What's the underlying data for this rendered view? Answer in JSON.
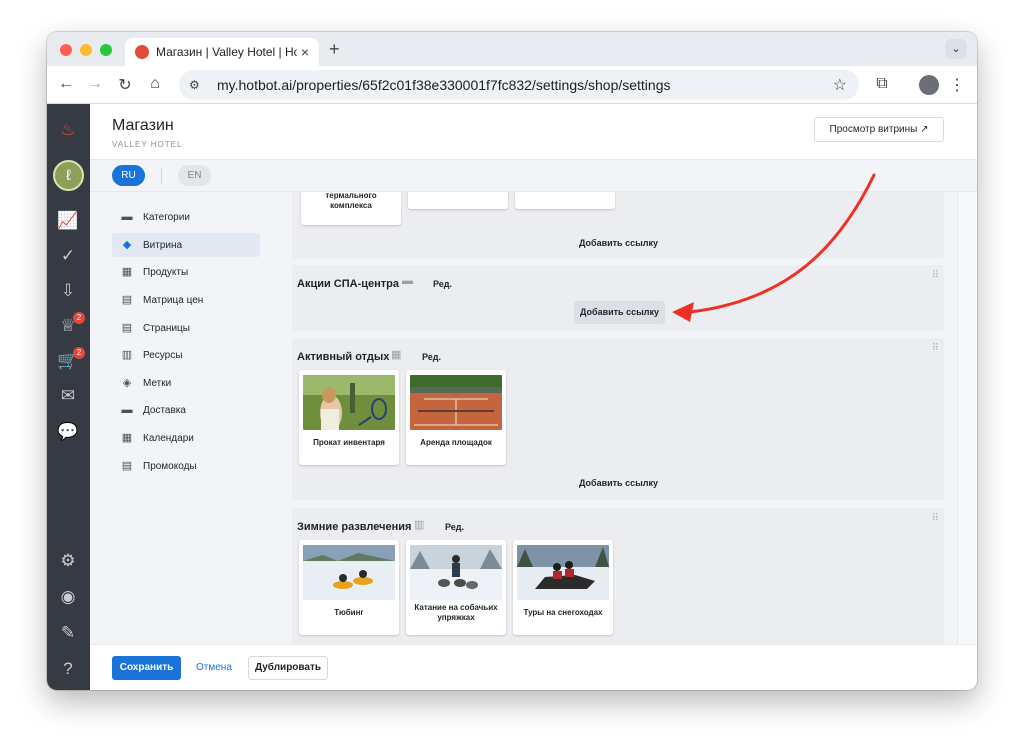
{
  "browser": {
    "tab_title": "Магазин | Valley Hotel | Hotbot",
    "tab_close": "×",
    "new_tab": "+",
    "url": "my.hotbot.ai/properties/65f2c01f38e330001f7fc832/settings/shop/settings"
  },
  "rail": {
    "badges": [
      "2",
      "2"
    ]
  },
  "header": {
    "title": "Магазин",
    "subtitle": "VALLEY HOTEL",
    "preview_label": "Просмотр витрины ↗"
  },
  "langs": [
    "RU",
    "EN"
  ],
  "nav": [
    {
      "label": "Категории",
      "icon": "▬"
    },
    {
      "label": "Витрина",
      "icon": "◆"
    },
    {
      "label": "Продукты",
      "icon": "▦"
    },
    {
      "label": "Матрица цен",
      "icon": "▤"
    },
    {
      "label": "Страницы",
      "icon": "▤"
    },
    {
      "label": "Ресурсы",
      "icon": "▥"
    },
    {
      "label": "Метки",
      "icon": "◈"
    },
    {
      "label": "Доставка",
      "icon": "▬"
    },
    {
      "label": "Календари",
      "icon": "▦"
    },
    {
      "label": "Промокоды",
      "icon": "▤"
    }
  ],
  "sections": {
    "top": {
      "card_caption": "термального комплекса",
      "add_link": "Добавить ссылку"
    },
    "spa": {
      "title": "Акции СПА-центра",
      "edit": "Ред.",
      "add_link": "Добавить ссылку"
    },
    "active": {
      "title": "Активный отдых",
      "edit": "Ред.",
      "cards": [
        "Прокат инвентаря",
        "Аренда площадок"
      ],
      "add_link": "Добавить ссылку"
    },
    "winter": {
      "title": "Зимние развлечения",
      "edit": "Ред.",
      "cards": [
        "Тюбинг",
        "Катание на собачьих упряжках",
        "Туры на снегоходах"
      ]
    }
  },
  "footer": {
    "save": "Сохранить",
    "cancel": "Отмена",
    "duplicate": "Дублировать"
  },
  "colors": {
    "accent": "#1a73d9",
    "annotation_arrow": "#ee3124",
    "badge": "#e5483b"
  }
}
